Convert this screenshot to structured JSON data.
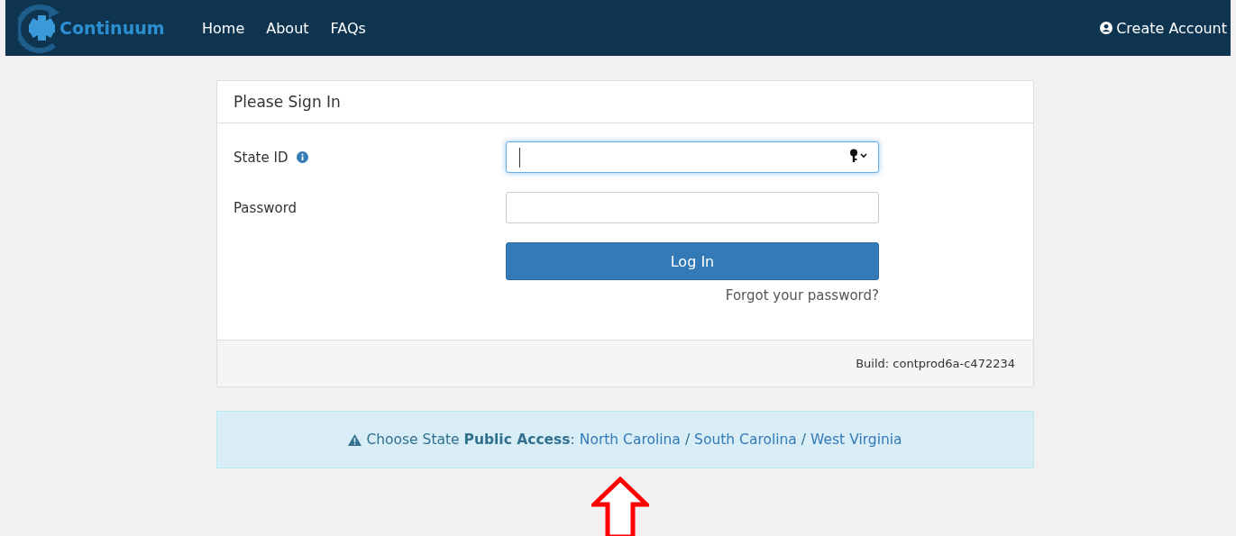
{
  "navbar": {
    "brand": "Continuum",
    "links": [
      {
        "label": "Home"
      },
      {
        "label": "About"
      },
      {
        "label": "FAQs"
      }
    ],
    "account_link": "Create Account"
  },
  "sign_in": {
    "title": "Please Sign In",
    "fields": [
      {
        "label": "State ID",
        "info": true,
        "focused": true,
        "autofill": true
      },
      {
        "label": "Password",
        "info": false,
        "focused": false,
        "autofill": false
      }
    ],
    "button": "Log In",
    "forgot": "Forgot your password?",
    "build": "Build: contprod6a-c472234"
  },
  "alert": {
    "text": "Choose State **Public Access**:",
    "states": [
      {
        "label": "North Carolina"
      },
      {
        "label": "South Carolina"
      },
      {
        "label": "West Virginia"
      }
    ],
    "separators": [
      "/",
      "/"
    ]
  },
  "annotation": {
    "kind": "arrow"
  }
}
